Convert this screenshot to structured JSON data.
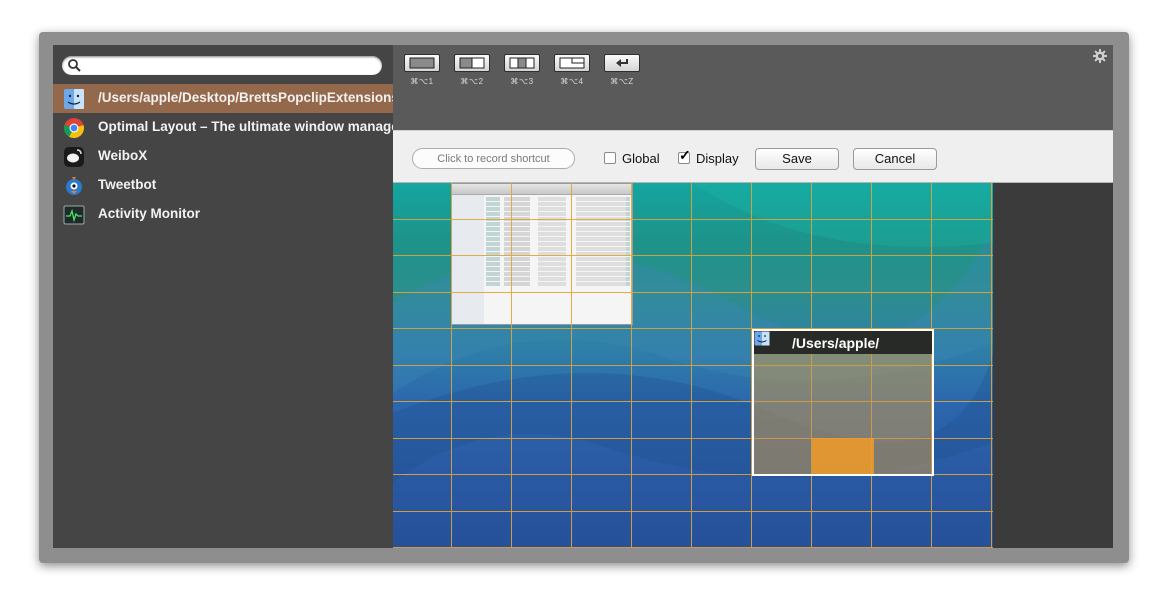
{
  "search": {
    "placeholder": "",
    "value": ""
  },
  "apps": [
    {
      "label": "/Users/apple/Desktop/BrettsPopclipExtensions",
      "icon": "finder-icon",
      "selected": true
    },
    {
      "label": "Optimal Layout – The ultimate window manager",
      "icon": "chrome-icon",
      "selected": false
    },
    {
      "label": "WeiboX",
      "icon": "weibox-icon",
      "selected": false
    },
    {
      "label": "Tweetbot",
      "icon": "tweetbot-icon",
      "selected": false
    },
    {
      "label": "Activity Monitor",
      "icon": "activity-monitor-icon",
      "selected": false
    }
  ],
  "toolbar": {
    "layouts": [
      {
        "icon": "full-layout-icon",
        "shortcut": "⌘⌥1"
      },
      {
        "icon": "halves-layout-icon",
        "shortcut": "⌘⌥2"
      },
      {
        "icon": "thirds-layout-icon",
        "shortcut": "⌘⌥3"
      },
      {
        "icon": "quarter-layout-icon",
        "shortcut": "⌘⌥4"
      },
      {
        "icon": "undo-arrow-icon",
        "shortcut": "⌘⌥Z"
      }
    ]
  },
  "record": {
    "shortcut_label": "Click to record shortcut",
    "global_label": "Global",
    "global_checked": false,
    "display_label": "Display",
    "display_checked": true,
    "save_label": "Save",
    "cancel_label": "Cancel"
  },
  "preview": {
    "selected_window_title": "/Users/apple/"
  },
  "colors": {
    "selection": "#94684a",
    "grid_line": "#e0a53a",
    "highlight": "#f09b28"
  }
}
